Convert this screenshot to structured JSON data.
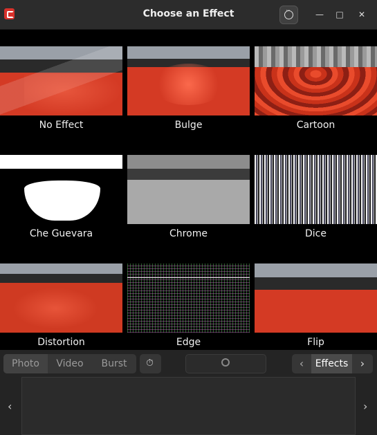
{
  "window": {
    "title": "Choose an Effect",
    "minimize": "—",
    "maximize": "□",
    "close": "✕"
  },
  "effects": [
    {
      "name": "No Effect",
      "style": "cam"
    },
    {
      "name": "Bulge",
      "style": "bulge"
    },
    {
      "name": "Cartoon",
      "style": "cartoon"
    },
    {
      "name": "Che Guevara",
      "style": "che"
    },
    {
      "name": "Chrome",
      "style": "chrome"
    },
    {
      "name": "Dice",
      "style": "dice"
    },
    {
      "name": "Distortion",
      "style": "distortion"
    },
    {
      "name": "Edge",
      "style": "edge"
    },
    {
      "name": "Flip",
      "style": "flip"
    }
  ],
  "bottombar": {
    "modes": [
      "Photo",
      "Video",
      "Burst"
    ],
    "active_mode": "Photo",
    "effects_label": "Effects",
    "nav_prev": "‹",
    "nav_next": "›",
    "gallery_prev": "‹",
    "gallery_next": "›"
  },
  "colors": {
    "accent": "#d43a24",
    "titlebar": "#2c2c2c",
    "bottombar": "#242424"
  }
}
